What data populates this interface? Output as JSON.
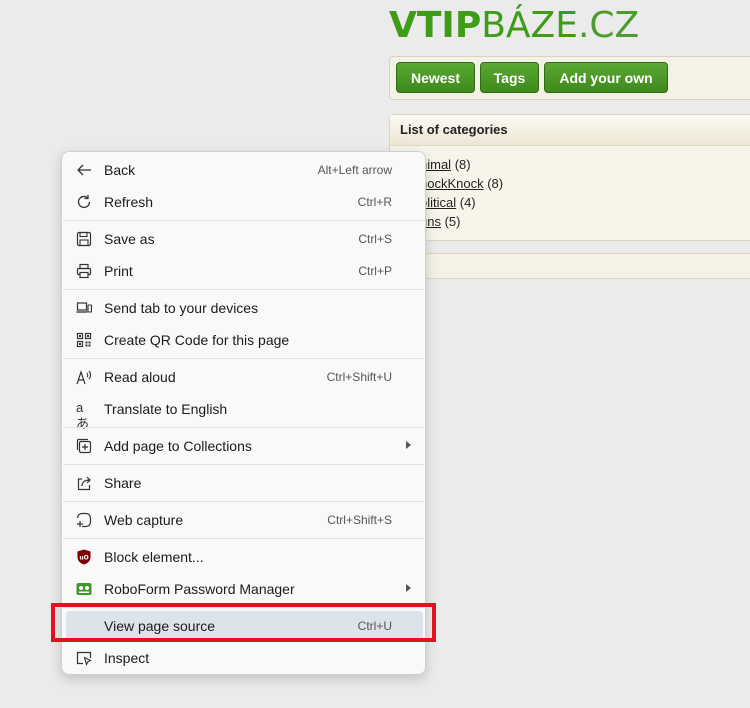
{
  "site": {
    "logo_bold": "VTIP",
    "logo_thin": "BÁZE",
    "logo_tld": ".CZ",
    "nav": [
      "Newest",
      "Tags",
      "Add your own"
    ],
    "categories_title": "List of categories",
    "categories": [
      {
        "name": "Animal",
        "visible_name": "nimal",
        "count": "(8)"
      },
      {
        "name": "KnockKnock",
        "visible_name": "nockKnock",
        "count": "(8)"
      },
      {
        "name": "Political",
        "visible_name": "olitical",
        "count": "(4)"
      },
      {
        "name": "Puns",
        "visible_name": "uns",
        "count": "(5)"
      }
    ]
  },
  "menu": {
    "items": [
      {
        "label": "Back",
        "shortcut": "Alt+Left arrow",
        "icon": "back-arrow-icon"
      },
      {
        "label": "Refresh",
        "shortcut": "Ctrl+R",
        "icon": "refresh-icon"
      },
      {
        "label": "Save as",
        "shortcut": "Ctrl+S",
        "icon": "save-icon"
      },
      {
        "label": "Print",
        "shortcut": "Ctrl+P",
        "icon": "printer-icon"
      },
      {
        "label": "Send tab to your devices",
        "shortcut": "",
        "icon": "devices-icon"
      },
      {
        "label": "Create QR Code for this page",
        "shortcut": "",
        "icon": "qr-code-icon"
      },
      {
        "label": "Read aloud",
        "shortcut": "Ctrl+Shift+U",
        "icon": "read-aloud-icon"
      },
      {
        "label": "Translate to English",
        "shortcut": "",
        "icon": "translate-icon"
      },
      {
        "label": "Add page to Collections",
        "shortcut": "",
        "icon": "collections-icon",
        "submenu": true
      },
      {
        "label": "Share",
        "shortcut": "",
        "icon": "share-icon"
      },
      {
        "label": "Web capture",
        "shortcut": "Ctrl+Shift+S",
        "icon": "web-capture-icon"
      },
      {
        "label": "Block element...",
        "shortcut": "",
        "icon": "ublock-icon"
      },
      {
        "label": "RoboForm Password Manager",
        "shortcut": "",
        "icon": "roboform-icon",
        "submenu": true
      },
      {
        "label": "View page source",
        "shortcut": "Ctrl+U",
        "icon": "",
        "highlighted": true
      },
      {
        "label": "Inspect",
        "shortcut": "",
        "icon": "inspect-icon"
      }
    ]
  },
  "colors": {
    "brand_green": "#3f9c19",
    "highlight_outline": "#e0141e",
    "menu_highlight": "#dde3ea"
  }
}
